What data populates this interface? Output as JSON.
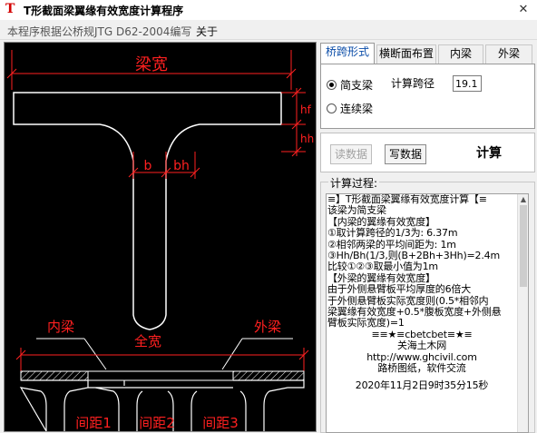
{
  "window": {
    "title": "T形截面梁翼缘有效宽度计算程序",
    "app_icon": "T",
    "close_glyph": "✕"
  },
  "menu": {
    "items": [
      "本程序根据公桥规JTG D62-2004编写",
      "关于"
    ]
  },
  "tabs": [
    "桥跨形式",
    "横断面布置",
    "内梁",
    "外梁"
  ],
  "span": {
    "options": [
      "简支梁",
      "连续梁"
    ],
    "selected": "简支梁",
    "span_label": "计算跨径",
    "span_value": "19.1"
  },
  "buttons": {
    "read": "读数据",
    "write": "写数据",
    "calc": "计算"
  },
  "output": {
    "group_label": "计算过程:",
    "lines": [
      "≡】T形截面梁翼缘有效宽度计算【≡",
      "该梁为简支梁",
      "【内梁的翼缘有效宽度】",
      "①取计算跨径的1/3为:    6.37m",
      "②相邻两梁的平均间距为:    1m",
      "③Hh/Bh(1/3,则(B+2Bh+3Hh)=2.4m",
      "比较①②③取最小值为1m",
      "【外梁的翼缘有效宽度】",
      "   由于外侧悬臂板平均厚度的6倍大",
      "于外侧悬臂板实际宽度则(0.5*相邻内",
      "梁翼缘有效宽度+0.5*腹板宽度+外侧悬",
      "臂板实际宽度)=1"
    ],
    "logo_lines": [
      "≡≡★≡cbetcbet≡★≡",
      "关海土木网",
      "http://www.ghcivil.com",
      "路桥图纸，软件交流"
    ],
    "timestamp": "2020年11月2日9时35分15秒"
  },
  "drawing": {
    "flange_width_label": "梁宽",
    "web_label": "b",
    "haunch_label": "bh",
    "flange_thick_label": "hf",
    "haunch_thick_label": "hh",
    "inner_beam_label": "内梁",
    "outer_beam_label": "外梁",
    "full_width_label": "全宽",
    "spacing_labels": [
      "间距1",
      "间距2",
      "间距3"
    ]
  },
  "colors": {
    "drawing_red": "#ff2020",
    "drawing_white": "#ffffff",
    "tab_active_text": "#0a4ca8"
  }
}
